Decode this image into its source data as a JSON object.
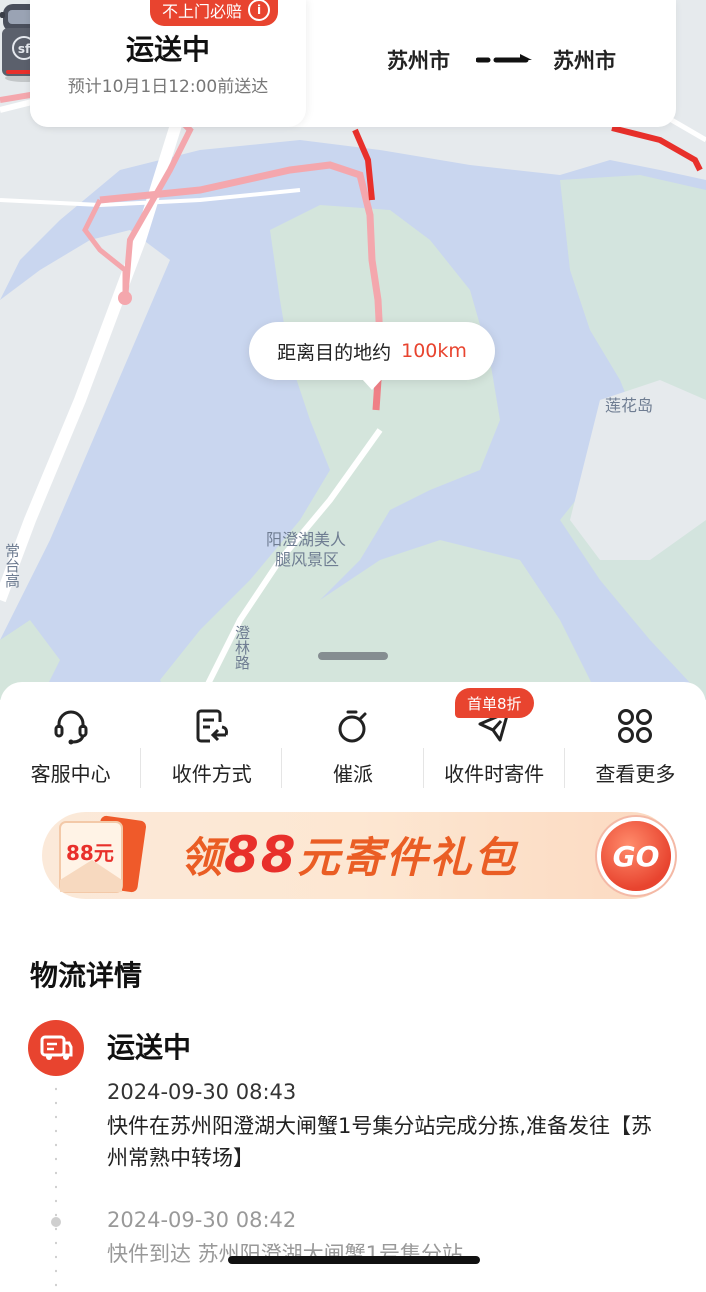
{
  "header": {
    "guarantee_badge": "不上门必赔",
    "status": "运送中",
    "eta": "预计10月1日12:00前送达",
    "from_city": "苏州市",
    "to_city": "苏州市"
  },
  "map": {
    "distance_label": "距离目的地约",
    "distance_value": "100km",
    "labels": {
      "island": "莲花岛",
      "scenic_line1": "阳澄湖美人",
      "scenic_line2": "腿风景区",
      "road_left": "常台高",
      "road_bottom": "澄林路"
    },
    "icons": [
      "truck-icon",
      "sf-logo-icon"
    ]
  },
  "actions": [
    {
      "label": "客服中心",
      "icon": "headset-icon"
    },
    {
      "label": "收件方式",
      "icon": "receive-method-icon"
    },
    {
      "label": "催派",
      "icon": "stopwatch-icon"
    },
    {
      "label": "收件时寄件",
      "icon": "paper-plane-icon",
      "tag": "首单8折"
    },
    {
      "label": "查看更多",
      "icon": "grid-more-icon"
    }
  ],
  "banner": {
    "prefix": "领",
    "amount": "88",
    "suffix": "元寄件礼包",
    "go": "GO",
    "envelope_text": "88元"
  },
  "logistics": {
    "title": "物流详情",
    "current_status": "运送中",
    "events": [
      {
        "time": "2024-09-30 08:43",
        "desc": "快件在苏州阳澄湖大闸蟹1号集分站完成分拣,准备发往【苏州常熟中转场】"
      },
      {
        "time": "2024-09-30 08:42",
        "desc": "快件到达 苏州阳澄湖大闸蟹1号集分站"
      }
    ]
  },
  "colors": {
    "accent": "#e8442f",
    "map_water": "#c9d6ef",
    "map_land": "#e6eaed",
    "map_green": "#d4e5dc"
  }
}
